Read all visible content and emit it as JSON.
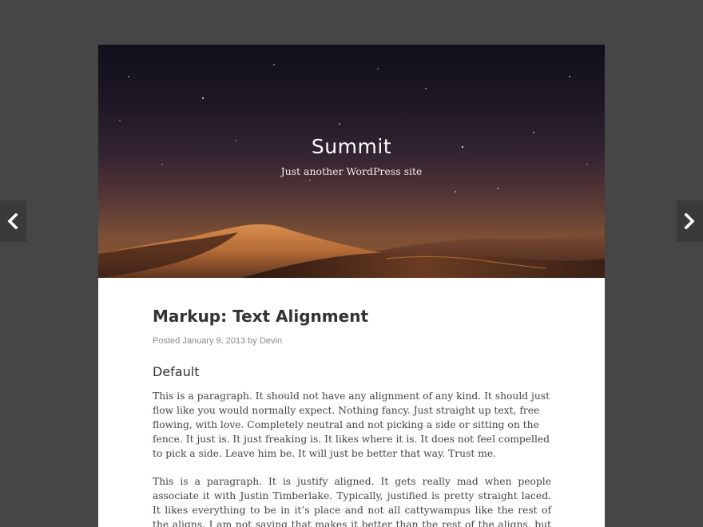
{
  "site": {
    "title": "Summit",
    "tagline": "Just another WordPress site"
  },
  "post": {
    "title": "Markup: Text Alignment",
    "meta": {
      "posted_label": "Posted",
      "date": "January 9, 2013",
      "by_label": "by",
      "author": "Devin"
    },
    "section_heading": "Default",
    "paragraphs": [
      "This is a paragraph. It should not have any alignment of any kind. It should just flow like you would normally expect. Nothing fancy. Just straight up text, free flowing, with love. Completely neutral and not picking a side or sitting on the fence. It just is. It just freaking is. It likes where it is. It does not feel compelled to pick a side. Leave him be. It will just be better that way. Trust me.",
      "This is a paragraph. It is justify aligned. It gets really mad when people associate it with Justin Timberlake. Typically, justified is pretty straight laced. It likes everything to be in it’s place and not all cattywampus like the rest of the aligns. I am not saying that makes it better than the rest of the aligns, but it does tend to put off more of an elitist attitude."
    ]
  },
  "nav": {
    "previous_icon": "chevron-left-icon",
    "next_icon": "chevron-right-icon"
  },
  "colors": {
    "background": "#464646",
    "page": "#ffffff",
    "text": "#444444",
    "meta": "#8a8a8a",
    "nav_button": "#3a3a3a"
  }
}
